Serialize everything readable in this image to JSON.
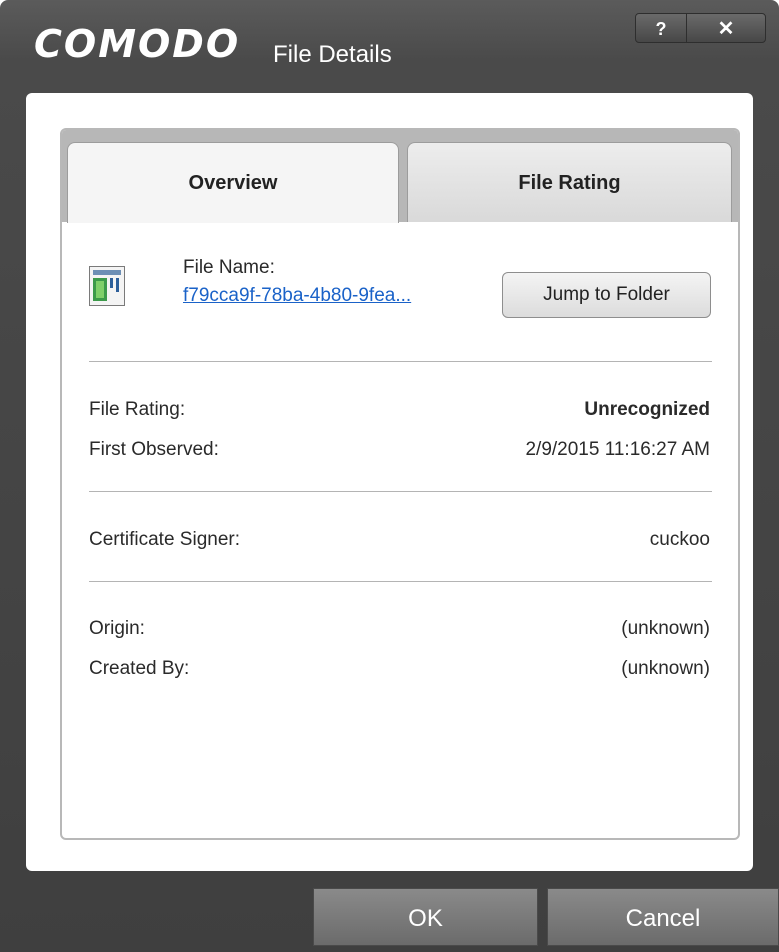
{
  "window": {
    "brand": "COMODO",
    "title": "File Details",
    "help_label": "?",
    "close_label": "✕"
  },
  "tabs": [
    {
      "label": "Overview",
      "active": true
    },
    {
      "label": "File Rating",
      "active": false
    }
  ],
  "file": {
    "name_label": "File Name:",
    "name_value": "f79cca9f-78ba-4b80-9fea...",
    "jump_button": "Jump to Folder"
  },
  "details": {
    "file_rating_label": "File Rating:",
    "file_rating_value": "Unrecognized",
    "first_observed_label": "First Observed:",
    "first_observed_value": "2/9/2015 11:16:27 AM",
    "certificate_signer_label": "Certificate Signer:",
    "certificate_signer_value": "cuckoo",
    "origin_label": "Origin:",
    "origin_value": "(unknown)",
    "created_by_label": "Created By:",
    "created_by_value": "(unknown)"
  },
  "footer": {
    "ok_label": "OK",
    "cancel_label": "Cancel"
  },
  "colors": {
    "link": "#1a62c8",
    "titlebar": "#4a4a4a"
  }
}
